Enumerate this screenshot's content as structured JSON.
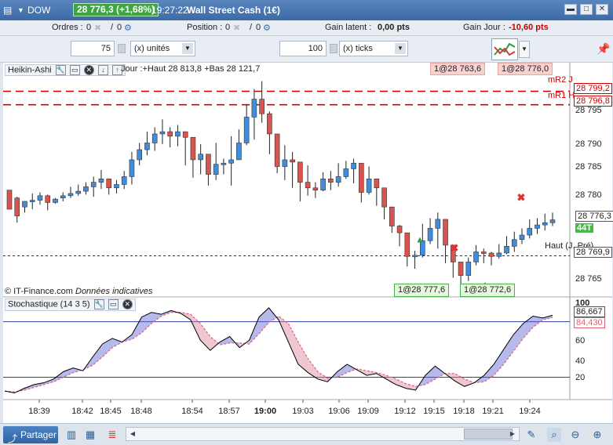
{
  "titlebar": {
    "instrument": "DOW",
    "price_badge": "28 776,3 (+1,68%)",
    "time": "19:27:22",
    "name": "Wall Street Cash (1€)",
    "win_buttons": [
      "▬",
      "□",
      "✕"
    ]
  },
  "infobar": {
    "orders_label": "Ordres :",
    "orders_value1": "0",
    "orders_sep": "/",
    "orders_value2": "0",
    "position_label": "Position :",
    "position_value1": "0",
    "position_sep": "/",
    "position_value2": "0",
    "latent_label": "Gain latent :",
    "latent_value": "0,00 pts",
    "day_label": "Gain Jour :",
    "day_value": "-10,60 pts"
  },
  "parambar": {
    "qty_value": "75",
    "qty_unit": "(x) unités",
    "ticks_value": "100",
    "ticks_unit": "(x) ticks"
  },
  "chart_header": {
    "indicator": "Heikin-Ashi",
    "day_info": "Jour :+Haut 28 813,8 +Bas 28 121,7",
    "order_buy": "1@28 763,6",
    "order_sell": "1@28 776,0"
  },
  "price_axis": {
    "levels": [
      "28 800",
      "28 795",
      "28 790",
      "28 785",
      "28 780",
      "28 775",
      "28 770",
      "28 765"
    ],
    "mR2_label": "mR2 J",
    "mR2_value": "28 799,2",
    "mR1_label": "mR1 H",
    "mR1_value": "28 796,8",
    "last_price": "28 776,3",
    "badge_44t": "44T",
    "haut_prev_label": "Haut (J. Pré)",
    "haut_prev_value": "28 769,9"
  },
  "annotations": {
    "copyright": "© IT-Finance.com",
    "indicative": "Données indicatives",
    "order_a": "1@28 777,6",
    "order_b": "1@28 772,6"
  },
  "stoch": {
    "title": "Stochastique (14 3 5)",
    "levels": [
      "100",
      "80",
      "60",
      "40",
      "20"
    ],
    "k_value": "86,667",
    "d_value": "84,430"
  },
  "time_axis": {
    "labels": [
      "18:39",
      "18:42",
      "18:45",
      "18:48",
      "18:54",
      "18:57",
      "19:00",
      "19:03",
      "19:06",
      "19:09",
      "19:12",
      "19:15",
      "19:18",
      "19:21",
      "19:24"
    ]
  },
  "bottombar": {
    "share_label": "Partager"
  },
  "colors": {
    "up": "#3f8ddb",
    "down": "#d9534f",
    "resistance": "#d00000",
    "k_line": "#000000",
    "d_line": "#e0607a"
  },
  "chart_data": {
    "type": "candlestick",
    "series": [
      {
        "name": "Heikin-Ashi",
        "ohlc": [
          [
            28781.6,
            28778.2,
            28779.0,
            28778.2
          ],
          [
            28780.2,
            28777.0,
            28780.4,
            28775.8
          ],
          [
            28778.6,
            28779.6,
            28779.6,
            28777.6
          ],
          [
            28779.6,
            28779.8,
            28781.0,
            28778.2
          ],
          [
            28779.8,
            28780.6,
            28781.2,
            28779.0
          ],
          [
            28780.6,
            28779.4,
            28780.8,
            28778.0
          ],
          [
            28779.4,
            28780.0,
            28780.2,
            28779.2
          ],
          [
            28780.2,
            28780.6,
            28781.2,
            28779.6
          ],
          [
            28780.6,
            28781.0,
            28782.2,
            28780.2
          ],
          [
            28781.0,
            28781.4,
            28782.6,
            28780.6
          ],
          [
            28781.4,
            28782.2,
            28783.0,
            28780.8
          ],
          [
            28782.2,
            28783.0,
            28784.0,
            28780.4
          ],
          [
            28783.0,
            28783.6,
            28785.2,
            28781.8
          ],
          [
            28783.6,
            28782.0,
            28783.6,
            28780.8
          ],
          [
            28782.0,
            28782.6,
            28783.4,
            28781.0
          ],
          [
            28782.6,
            28784.0,
            28785.0,
            28781.8
          ],
          [
            28784.0,
            28787.0,
            28788.4,
            28782.6
          ],
          [
            28787.0,
            28788.8,
            28790.0,
            28786.0
          ],
          [
            28788.8,
            28790.0,
            28792.0,
            28787.8
          ],
          [
            28790.0,
            28791.6,
            28792.8,
            28788.6
          ],
          [
            28791.6,
            28792.0,
            28794.2,
            28789.8
          ],
          [
            28792.0,
            28791.2,
            28792.8,
            28789.2
          ],
          [
            28791.2,
            28792.0,
            28793.2,
            28789.4
          ],
          [
            28792.0,
            28791.0,
            28792.0,
            28786.0
          ],
          [
            28791.0,
            28787.0,
            28791.0,
            28783.8
          ],
          [
            28787.0,
            28788.0,
            28789.8,
            28784.4
          ],
          [
            28788.0,
            28784.4,
            28788.0,
            28782.4
          ],
          [
            28784.4,
            28786.2,
            28790.0,
            28783.4
          ],
          [
            28786.2,
            28786.4,
            28787.2,
            28784.4
          ],
          [
            28786.4,
            28787.0,
            28791.2,
            28782.4
          ],
          [
            28787.0,
            28790.0,
            28792.4,
            28788.4
          ],
          [
            28790.0,
            28794.6,
            28796.8,
            28789.6
          ],
          [
            28794.6,
            28797.8,
            28799.6,
            28790.6
          ],
          [
            28797.8,
            28795.2,
            28801.0,
            28793.6
          ],
          [
            28795.2,
            28791.6,
            28795.6,
            28788.0
          ],
          [
            28791.6,
            28785.8,
            28791.6,
            28784.6
          ],
          [
            28785.8,
            28787.0,
            28789.6,
            28783.4
          ],
          [
            28787.0,
            28786.6,
            28788.4,
            28782.0
          ],
          [
            28786.6,
            28783.0,
            28786.6,
            28779.6
          ],
          [
            28783.0,
            28782.0,
            28786.0,
            28780.6
          ],
          [
            28782.0,
            28781.6,
            28783.0,
            28780.2
          ],
          [
            28781.6,
            28783.6,
            28784.8,
            28781.4
          ],
          [
            28783.6,
            28783.0,
            28785.0,
            28781.6
          ],
          [
            28783.0,
            28784.0,
            28786.4,
            28782.2
          ],
          [
            28784.0,
            28785.4,
            28786.8,
            28783.6
          ],
          [
            28785.4,
            28786.4,
            28787.2,
            28782.8
          ],
          [
            28786.4,
            28781.2,
            28786.4,
            28779.4
          ],
          [
            28781.2,
            28783.6,
            28785.8,
            28780.8
          ],
          [
            28783.6,
            28782.0,
            28783.6,
            28778.8
          ],
          [
            28782.0,
            28778.6,
            28782.0,
            28776.4
          ],
          [
            28778.6,
            28775.2,
            28778.6,
            28774.0
          ],
          [
            28775.2,
            28774.0,
            28775.4,
            28771.6
          ],
          [
            28774.0,
            28769.8,
            28774.0,
            28768.0
          ],
          [
            28769.8,
            28770.0,
            28770.8,
            28767.6
          ],
          [
            28770.0,
            28772.6,
            28775.6,
            28769.6
          ],
          [
            28772.6,
            28774.8,
            28776.6,
            28772.0
          ],
          [
            28774.8,
            28776.4,
            28777.6,
            28771.2
          ],
          [
            28776.4,
            28771.8,
            28776.4,
            28768.6
          ],
          [
            28771.8,
            28768.8,
            28771.8,
            28766.0
          ],
          [
            28768.8,
            28766.4,
            28768.8,
            28763.6
          ],
          [
            28766.4,
            28768.8,
            28769.6,
            28765.4
          ],
          [
            28768.8,
            28770.6,
            28771.8,
            28768.2
          ],
          [
            28770.6,
            28770.4,
            28771.2,
            28768.6
          ],
          [
            28770.4,
            28769.8,
            28770.6,
            28768.2
          ],
          [
            28769.8,
            28770.4,
            28772.0,
            28769.4
          ],
          [
            28770.4,
            28771.6,
            28773.4,
            28770.2
          ],
          [
            28771.6,
            28772.8,
            28774.2,
            28770.6
          ],
          [
            28772.8,
            28773.6,
            28774.8,
            28772.0
          ],
          [
            28773.6,
            28774.8,
            28776.4,
            28773.0
          ],
          [
            28774.8,
            28775.4,
            28776.6,
            28773.8
          ],
          [
            28775.4,
            28775.8,
            28777.4,
            28774.4
          ],
          [
            28775.8,
            28776.3,
            28777.6,
            28775.2
          ]
        ]
      }
    ],
    "stochastic_k": [
      5,
      3,
      8,
      12,
      14,
      18,
      26,
      30,
      27,
      42,
      56,
      62,
      58,
      66,
      85,
      90,
      88,
      92,
      89,
      82,
      60,
      49,
      58,
      64,
      52,
      60,
      85,
      95,
      82,
      58,
      34,
      25,
      18,
      15,
      26,
      34,
      28,
      22,
      24,
      18,
      12,
      8,
      6,
      22,
      32,
      24,
      16,
      10,
      14,
      22,
      34,
      50,
      66,
      78,
      86,
      84,
      87
    ],
    "stochastic_d": [
      5,
      4,
      6,
      9,
      12,
      15,
      20,
      25,
      28,
      33,
      42,
      52,
      58,
      61,
      68,
      78,
      86,
      90,
      90,
      88,
      78,
      64,
      55,
      57,
      57,
      56,
      67,
      79,
      86,
      78,
      58,
      40,
      26,
      19,
      20,
      25,
      29,
      27,
      25,
      22,
      18,
      13,
      10,
      12,
      18,
      24,
      24,
      18,
      14,
      15,
      22,
      34,
      48,
      62,
      74,
      82,
      84.4
    ]
  }
}
